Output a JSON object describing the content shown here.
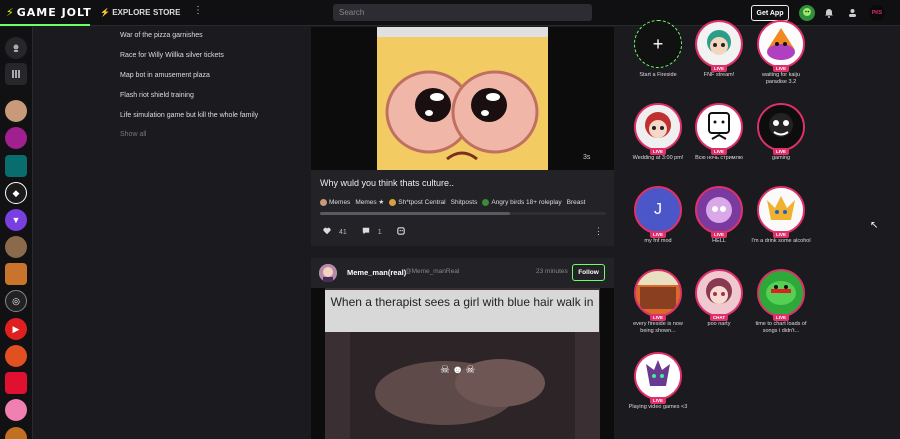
{
  "topbar": {
    "logo": "GAME JOLT",
    "explore_label": "EXPLORE",
    "store_label": "STORE",
    "more_icon": "more-vertical-icon",
    "search_placeholder": "Search",
    "get_app_label": "Get App",
    "avatar_initials": "PKS"
  },
  "sidebar_links": [
    "War of the pizza garnishes",
    "Race for Willy Willka silver tickets",
    "Map bot in amusement plaza",
    "Flash riot shield training",
    "Life simulation game but kill the whole family"
  ],
  "sidebar_show_all": "Show all",
  "post1": {
    "duration": "3s",
    "title": "Why wuld you think thats culture..",
    "tags": [
      "Memes",
      "Memes ★",
      "Sh*tpost Central",
      "Shitposts",
      "Angry birds 18+ roleplay",
      "Breast"
    ],
    "likes": "41",
    "comments": "1"
  },
  "post2": {
    "username": "Meme_man(real)",
    "handle": "@Meme_manReal",
    "time": "23 minutes",
    "follow_label": "Follow",
    "caption": "When a therapist sees a girl with blue hair walk in"
  },
  "firesides": [
    {
      "label": "Start a Fireside",
      "live": ""
    },
    {
      "label": "FNF stream!",
      "live": "LIVE"
    },
    {
      "label": "waiting for kaiju paradise 3.2",
      "live": "LIVE"
    },
    {
      "label": "Wedding at 3:00 pm!",
      "live": "LIVE"
    },
    {
      "label": "Всю ночь стримлю",
      "live": "LIVE"
    },
    {
      "label": "gaming",
      "live": "LIVE"
    },
    {
      "label": "my fnf mod",
      "live": "LIVE"
    },
    {
      "label": "HELL",
      "live": "LIVE"
    },
    {
      "label": "I'm a drink some alcohol",
      "live": "LIVE"
    },
    {
      "label": "every fireside is now being shown...",
      "live": "LIVE"
    },
    {
      "label": "poo narty",
      "live": "CHAT"
    },
    {
      "label": "time to chart loads of songs i didn't...",
      "live": "LIVE"
    },
    {
      "label": "Playing video games <3",
      "live": "LIVE"
    }
  ],
  "colors": {
    "accent": "#6bff6b",
    "live": "#e0306a",
    "background": "#1b1b1f"
  }
}
